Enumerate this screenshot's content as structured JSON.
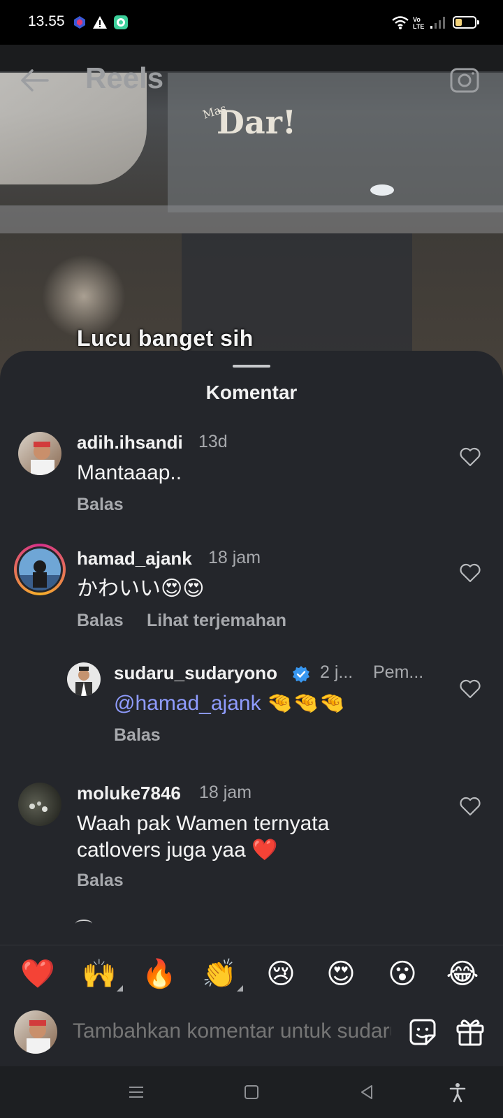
{
  "status_bar": {
    "time": "13.55",
    "network_label": "Vo LTE",
    "battery_percent": 35,
    "icons": [
      "app-notification-icon",
      "warning-icon",
      "messenger-icon",
      "wifi-icon",
      "volte-icon",
      "signal-icon",
      "battery-icon"
    ]
  },
  "header": {
    "title": "Reels",
    "back_icon": "arrow-left-icon",
    "camera_icon": "camera-icon"
  },
  "reel": {
    "logo_small": "Mas",
    "logo": "Dar!",
    "caption": "Lucu banget sih"
  },
  "sheet": {
    "title": "Komentar"
  },
  "comments": [
    {
      "username": "adih.ihsandi",
      "time": "13d",
      "text": "Mantaaap..",
      "reply_label": "Balas"
    },
    {
      "username": "hamad_ajank",
      "time": "18 jam",
      "text": "かわいい😍😍",
      "reply_label": "Balas",
      "translate_label": "Lihat terjemahan"
    },
    {
      "username": "sudaru_sudaryono",
      "verified": true,
      "time": "2 j...",
      "extra": "Pem...",
      "mention": "@hamad_ajank",
      "text": " 🤏🤏🤏",
      "reply_label": "Balas"
    },
    {
      "username": "moluke7846",
      "time": "18 jam",
      "text_line1": "Waah pak Wamen ternyata",
      "text_line2": "catlovers juga yaa ❤️",
      "reply_label": "Balas"
    }
  ],
  "emoji_bar": [
    "❤️",
    "🙌",
    "🔥",
    "👏",
    "😢",
    "😍",
    "😮",
    "😂"
  ],
  "input": {
    "placeholder": "Tambahkan komentar untuk sudaru_sudaryono...",
    "sticker_icon": "sticker-icon",
    "gift_icon": "gift-icon"
  },
  "nav_bar": {
    "icons": [
      "menu-icon",
      "home-square-icon",
      "back-triangle-icon",
      "accessibility-icon"
    ]
  },
  "colors": {
    "sheet_bg": "#24262b",
    "mention": "#8f9cff",
    "verified": "#3897f0",
    "muted_text": "#a7a9ad"
  }
}
